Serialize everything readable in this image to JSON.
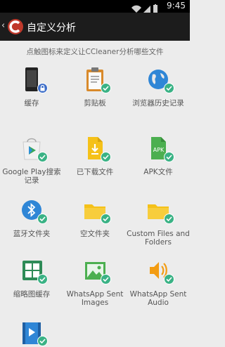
{
  "status_bar": {
    "time": "9:45"
  },
  "app_bar": {
    "title": "自定义分析"
  },
  "hint": "点触图标来定义让CCleaner分析哪些文件",
  "items": [
    {
      "label": "缓存",
      "icon": "phone-icon",
      "badge": "lock"
    },
    {
      "label": "剪贴板",
      "icon": "clipboard-icon",
      "badge": "check"
    },
    {
      "label": "浏览器历史记录",
      "icon": "globe-icon",
      "badge": "check"
    },
    {
      "label": "Google Play搜索记录",
      "icon": "google-play-icon",
      "badge": "check"
    },
    {
      "label": "已下载文件",
      "icon": "download-file-icon",
      "badge": "check"
    },
    {
      "label": "APK文件",
      "icon": "apk-file-icon",
      "badge": "check",
      "icon_text": "APK"
    },
    {
      "label": "蓝牙文件夹",
      "icon": "bluetooth-icon",
      "badge": "check"
    },
    {
      "label": "空文件夹",
      "icon": "folder-icon",
      "badge": "check"
    },
    {
      "label": "Custom Files and Folders",
      "icon": "folder-icon",
      "badge": "check"
    },
    {
      "label": "缩略图缓存",
      "icon": "thumbnail-icon",
      "badge": "check"
    },
    {
      "label": "WhatsApp Sent Images",
      "icon": "image-icon",
      "badge": "check"
    },
    {
      "label": "WhatsApp Sent Audio",
      "icon": "speaker-icon",
      "badge": "check"
    },
    {
      "label": "",
      "icon": "video-icon",
      "badge": "check"
    }
  ],
  "colors": {
    "accent_check": "#3ab285",
    "lock": "#3f6fc9",
    "folder": "#f5c119"
  }
}
